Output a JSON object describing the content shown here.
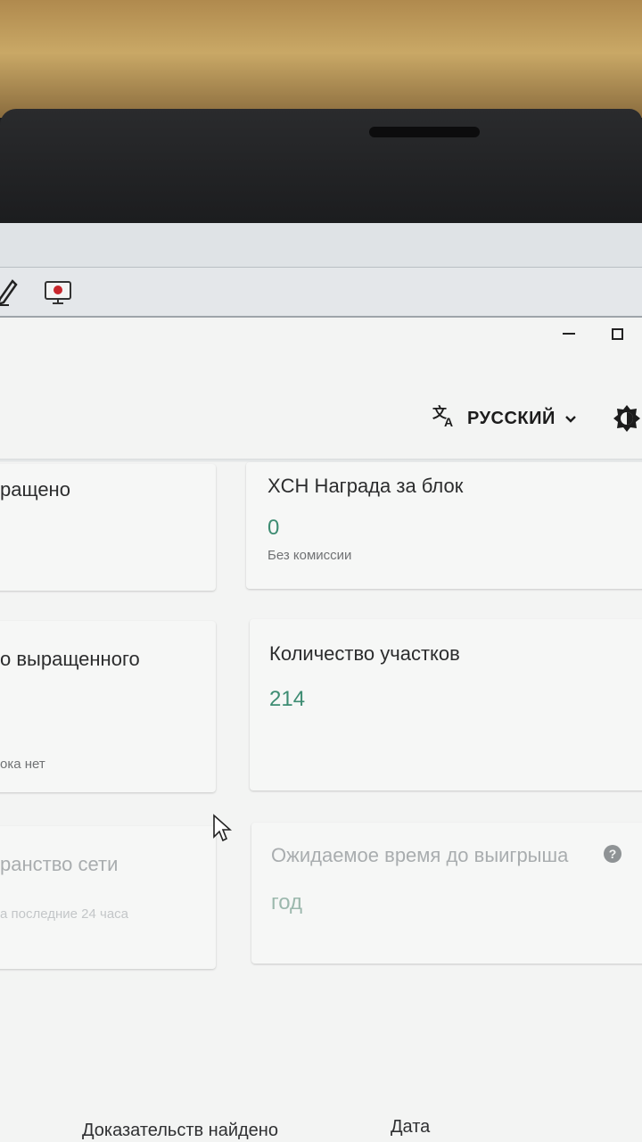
{
  "app": {
    "language_label": "РУССКИЙ",
    "icons": {
      "translate": "translate-icon",
      "chevron": "chevron-down-icon",
      "theme": "theme-toggle-icon"
    }
  },
  "cards": {
    "grown": {
      "title": "ращено"
    },
    "block_reward": {
      "title": "XCH Награда за блок",
      "value": "0",
      "subtitle": "Без комиссии"
    },
    "last_grown": {
      "title": "о выращенного",
      "subtitle": "ока нет"
    },
    "plot_count": {
      "title": "Количество участков",
      "value": "214"
    },
    "netspace": {
      "title": "ранство сети",
      "subtitle": "а последние 24 часа"
    },
    "time_to_win": {
      "title": "Ожидаемое время до выигрыша",
      "value": "год"
    }
  },
  "table": {
    "col_proofs": "Доказательств найдено",
    "col_date": "Дата"
  },
  "colors": {
    "accent_value": "#3d8c72",
    "bezel": "#1e1f21"
  }
}
